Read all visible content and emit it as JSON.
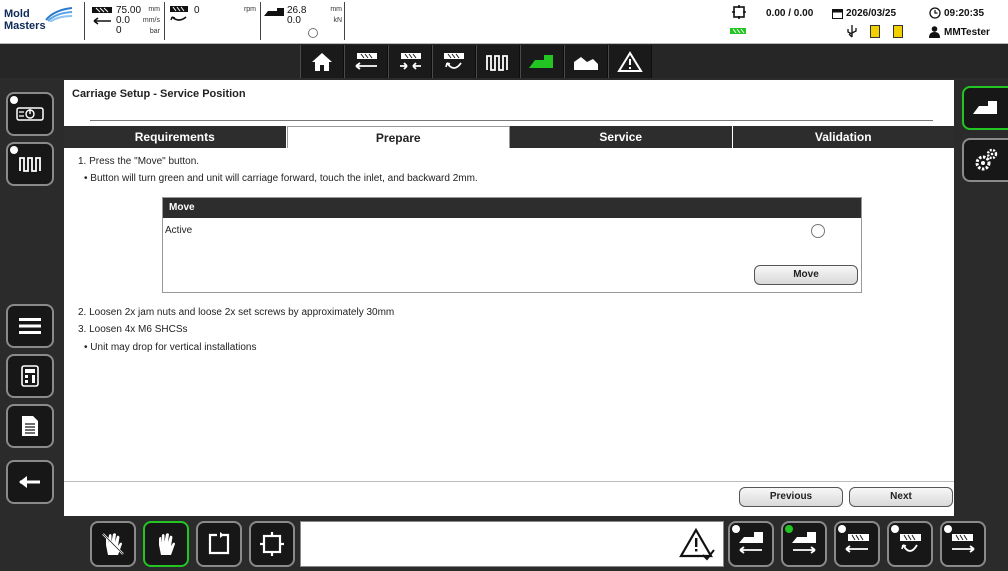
{
  "brand": {
    "line1": "Mold",
    "line2": "Masters"
  },
  "readouts": {
    "injection_position": "75.00",
    "injection_position_unit": "mm",
    "injection_speed": "0.0",
    "injection_speed_unit": "mm/s",
    "injection_pressure": "0",
    "injection_pressure_unit": "bar",
    "screw_rpm": "0",
    "screw_rpm_unit": "rpm",
    "carriage_position": "26.8",
    "carriage_position_unit": "mm",
    "carriage_force": "0.0",
    "carriage_force_unit": "kN"
  },
  "status": {
    "counter": "0.00 / 0.00",
    "date": "2026/03/25",
    "time": "09:20:35",
    "user": "MMTester"
  },
  "page": {
    "title": "Carriage Setup - Service Position",
    "tabs": [
      {
        "label": "Requirements",
        "active": false
      },
      {
        "label": "Prepare",
        "active": true
      },
      {
        "label": "Service",
        "active": false
      },
      {
        "label": "Validation",
        "active": false
      }
    ],
    "step1": "1. Press the \"Move\" button.",
    "step1_bullet": "• Button will turn green and unit will carriage forward, touch the inlet, and backward 2mm.",
    "move_panel": {
      "header": "Move",
      "active_label": "Active",
      "move_button": "Move"
    },
    "step2": "2. Loosen 2x jam nuts and loose 2x set screws by approximately 30mm",
    "step3": "3. Loosen 4x M6 SHCSs",
    "step3_bullet": "• Unit may drop for vertical installations",
    "previous_button": "Previous",
    "next_button": "Next"
  },
  "icons": {
    "navbar": [
      "home-icon",
      "injection-retract-icon",
      "injection-hold-icon",
      "screw-rotate-icon",
      "heater-icon",
      "carriage-icon",
      "profile-chart-icon",
      "alarm-warning-icon"
    ],
    "left_sidebar": [
      "power-icon",
      "heater-icon",
      "menu-icon",
      "calculator-icon",
      "document-icon",
      "back-arrow-icon"
    ],
    "right_sidebar": [
      "carriage-icon",
      "settings-gears-icon"
    ],
    "bottom_left": [
      "manual-hand-crossed-icon",
      "manual-hand-icon",
      "cycle-start-icon",
      "cycle-auto-icon"
    ],
    "bottom_right": [
      "carriage-back-icon",
      "carriage-forward-icon",
      "injection-retract-icon",
      "screw-rotate-icon",
      "injection-forward-icon"
    ]
  },
  "colors": {
    "accent_green": "#22c522",
    "dark_bg": "#2b2b2b",
    "header_bar": "#2d2d2d",
    "status_yellow": "#f0d000"
  }
}
